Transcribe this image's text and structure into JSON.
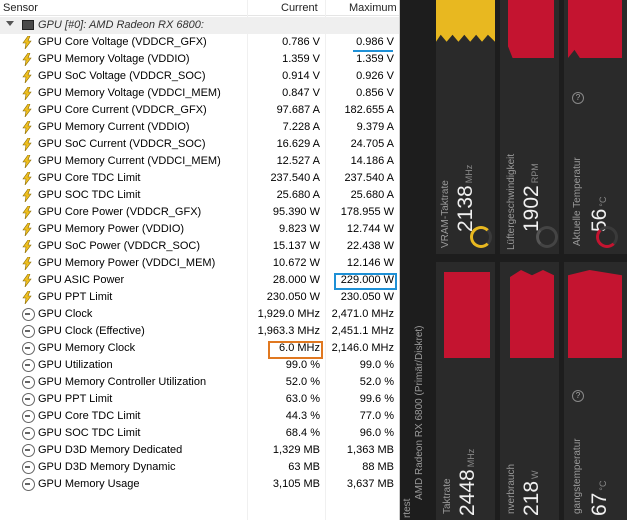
{
  "headers": {
    "sensor": "Sensor",
    "current": "Current",
    "maximum": "Maximum"
  },
  "group": {
    "label": "GPU [#0]: AMD Radeon RX 6800:"
  },
  "rows": [
    {
      "name": "GPU Core Voltage (VDDCR_GFX)",
      "current": "0.786 V",
      "maximum": "0.986 V",
      "icon": "bolt-icon"
    },
    {
      "name": "GPU Memory Voltage (VDDIO)",
      "current": "1.359 V",
      "maximum": "1.359 V",
      "icon": "bolt-icon"
    },
    {
      "name": "GPU SoC Voltage (VDDCR_SOC)",
      "current": "0.914 V",
      "maximum": "0.926 V",
      "icon": "bolt-icon"
    },
    {
      "name": "GPU Memory Voltage (VDDCI_MEM)",
      "current": "0.847 V",
      "maximum": "0.856 V",
      "icon": "bolt-icon"
    },
    {
      "name": "GPU Core Current (VDDCR_GFX)",
      "current": "97.687 A",
      "maximum": "182.655 A",
      "icon": "bolt-icon"
    },
    {
      "name": "GPU Memory Current (VDDIO)",
      "current": "7.228 A",
      "maximum": "9.379 A",
      "icon": "bolt-icon"
    },
    {
      "name": "GPU SoC Current (VDDCR_SOC)",
      "current": "16.629 A",
      "maximum": "24.705 A",
      "icon": "bolt-icon"
    },
    {
      "name": "GPU Memory Current (VDDCI_MEM)",
      "current": "12.527 A",
      "maximum": "14.186 A",
      "icon": "bolt-icon"
    },
    {
      "name": "GPU Core TDC Limit",
      "current": "237.540 A",
      "maximum": "237.540 A",
      "icon": "bolt-icon"
    },
    {
      "name": "GPU SOC TDC Limit",
      "current": "25.680 A",
      "maximum": "25.680 A",
      "icon": "bolt-icon"
    },
    {
      "name": "GPU Core Power (VDDCR_GFX)",
      "current": "95.390 W",
      "maximum": "178.955 W",
      "icon": "bolt-icon"
    },
    {
      "name": "GPU Memory Power (VDDIO)",
      "current": "9.823 W",
      "maximum": "12.744 W",
      "icon": "bolt-icon"
    },
    {
      "name": "GPU SoC Power (VDDCR_SOC)",
      "current": "15.137 W",
      "maximum": "22.438 W",
      "icon": "bolt-icon"
    },
    {
      "name": "GPU Memory Power (VDDCI_MEM)",
      "current": "10.672 W",
      "maximum": "12.146 W",
      "icon": "bolt-icon"
    },
    {
      "name": "GPU ASIC Power",
      "current": "28.000 W",
      "maximum": "229.000 W",
      "icon": "bolt-icon"
    },
    {
      "name": "GPU PPT Limit",
      "current": "230.050 W",
      "maximum": "230.050 W",
      "icon": "bolt-icon"
    },
    {
      "name": "GPU Clock",
      "current": "1,929.0 MHz",
      "maximum": "2,471.0 MHz",
      "icon": "clock-icon"
    },
    {
      "name": "GPU Clock (Effective)",
      "current": "1,963.3 MHz",
      "maximum": "2,451.1 MHz",
      "icon": "clock-icon"
    },
    {
      "name": "GPU Memory Clock",
      "current": "6.0 MHz",
      "maximum": "2,146.0 MHz",
      "icon": "clock-icon"
    },
    {
      "name": "GPU Utilization",
      "current": "99.0 %",
      "maximum": "99.0 %",
      "icon": "clock-icon"
    },
    {
      "name": "GPU Memory Controller Utilization",
      "current": "52.0 %",
      "maximum": "52.0 %",
      "icon": "clock-icon"
    },
    {
      "name": "GPU PPT Limit",
      "current": "63.0 %",
      "maximum": "99.6 %",
      "icon": "clock-icon"
    },
    {
      "name": "GPU Core TDC Limit",
      "current": "44.3 %",
      "maximum": "77.0 %",
      "icon": "clock-icon"
    },
    {
      "name": "GPU SOC TDC Limit",
      "current": "68.4 %",
      "maximum": "96.0 %",
      "icon": "clock-icon"
    },
    {
      "name": "GPU D3D Memory Dedicated",
      "current": "1,329 MB",
      "maximum": "1,363 MB",
      "icon": "clock-icon"
    },
    {
      "name": "GPU D3D Memory Dynamic",
      "current": "63 MB",
      "maximum": "88 MB",
      "icon": "clock-icon"
    },
    {
      "name": "GPU Memory Usage",
      "current": "3,105 MB",
      "maximum": "3,637 MB",
      "icon": "clock-icon"
    }
  ],
  "dashboard": {
    "gpu_label": "AMD Radeon RX 6800 (Primär/Diskret)",
    "cut_label_left": "rtest",
    "top_cards": [
      {
        "label": "VRAM-Taktrate",
        "value": "2138",
        "unit": "MHz"
      },
      {
        "label": "Lüftergeschwindigkeit",
        "value": "1902",
        "unit": "RPM"
      },
      {
        "label": "Aktuelle Temperatur",
        "value": "56",
        "unit": "°C"
      }
    ],
    "bottom_cards": [
      {
        "label": "Taktrate",
        "value": "2448",
        "unit": "MHz"
      },
      {
        "label": "nverbrauch",
        "value": "218",
        "unit": "W"
      },
      {
        "label": "gangstemperatur",
        "value": "67",
        "unit": "°C"
      }
    ],
    "help_glyph": "?"
  },
  "colors": {
    "highlight_blue": "#1e90d6",
    "highlight_orange": "#e07820",
    "graph_yellow": "#e8b820",
    "graph_red": "#c41430"
  }
}
